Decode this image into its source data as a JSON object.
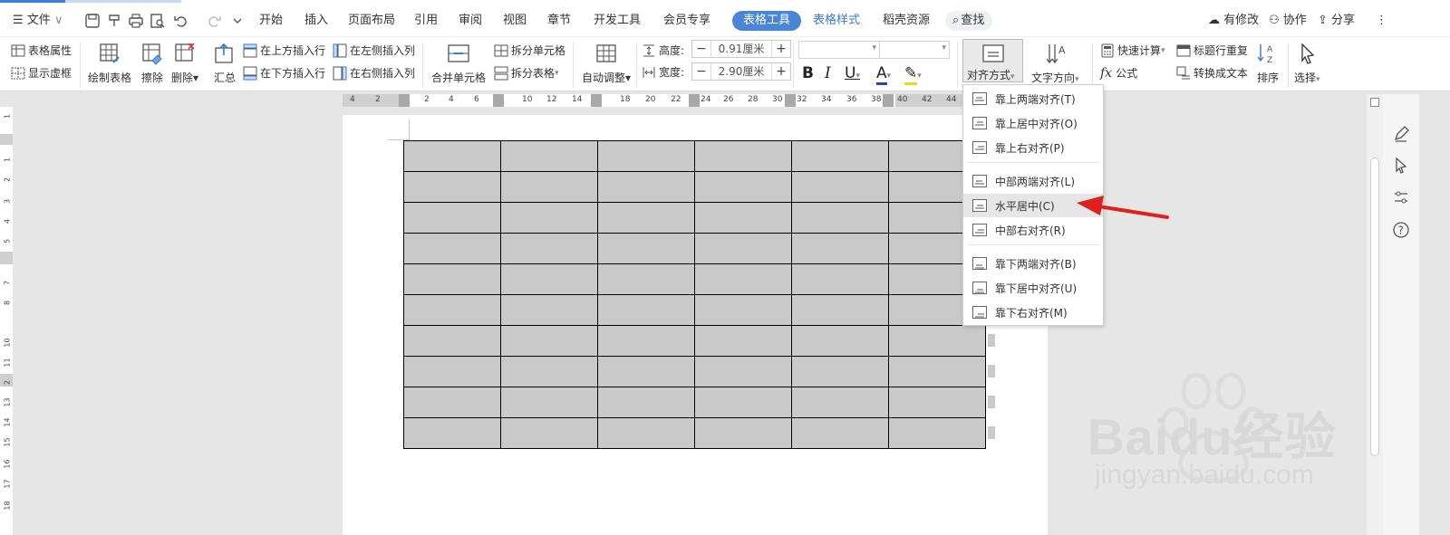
{
  "menubar": {
    "file_label": "文件",
    "tabs": [
      "开始",
      "插入",
      "页面布局",
      "引用",
      "审阅",
      "视图",
      "章节",
      "开发工具",
      "会员专享"
    ],
    "active_tab": "表格工具",
    "style_tab": "表格样式",
    "resource_tab": "稻壳资源",
    "search_label": "查找",
    "modified_label": "有修改",
    "collab_label": "协作",
    "share_label": "分享"
  },
  "toolbar": {
    "table_props": "表格属性",
    "show_gridlines": "显示虚框",
    "draw_table": "绘制表格",
    "erase": "擦除",
    "delete": "删除",
    "summary": "汇总",
    "insert_row_above": "在上方插入行",
    "insert_row_below": "在下方插入行",
    "insert_col_left": "在左侧插入列",
    "insert_col_right": "在右侧插入列",
    "merge_cells": "合并单元格",
    "split_cells": "拆分单元格",
    "split_table": "拆分表格",
    "auto_fit": "自动调整",
    "height_label": "高度:",
    "height_value": "0.91厘米",
    "width_label": "宽度:",
    "width_value": "2.90厘米",
    "align_label": "对齐方式",
    "text_direction": "文字方向",
    "quick_calc": "快速计算",
    "formula": "公式",
    "repeat_header": "标题行重复",
    "convert_text": "转换成文本",
    "sort": "排序",
    "select": "选择"
  },
  "hruler_ticks": [
    "4",
    "2",
    "2",
    "4",
    "6",
    "10",
    "12",
    "14",
    "18",
    "20",
    "22",
    "24",
    "26",
    "28",
    "30",
    "32",
    "34",
    "36",
    "38",
    "40",
    "42",
    "44"
  ],
  "vruler_ticks": [
    "1",
    "1",
    "2",
    "3",
    "4",
    "5",
    "7",
    "8",
    "10",
    "11",
    "2",
    "13",
    "14",
    "15",
    "16",
    "17",
    "18"
  ],
  "align_menu": {
    "items": [
      "靠上两端对齐(T)",
      "靠上居中对齐(O)",
      "靠上右对齐(P)",
      "中部两端对齐(L)",
      "水平居中(C)",
      "中部右对齐(R)",
      "靠下两端对齐(B)",
      "靠下居中对齐(U)",
      "靠下右对齐(M)"
    ],
    "highlighted_index": 4
  },
  "table": {
    "rows": 10,
    "cols": 6,
    "cell_color": "#c9c9c9"
  },
  "watermark": {
    "brand": "Baidu经验",
    "url": "jingyan.baidu.com"
  },
  "colors": {
    "accent": "#4a86d8",
    "arrow": "#e0201e"
  }
}
